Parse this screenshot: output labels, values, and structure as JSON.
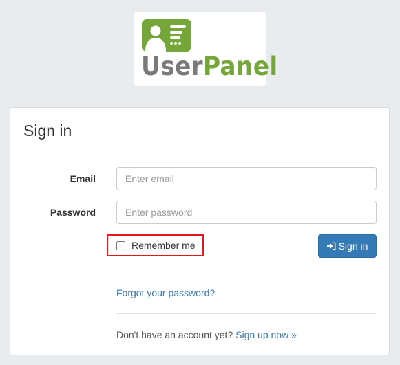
{
  "logo": {
    "text_user": "User",
    "text_panel": "Panel",
    "icon": "user-card-icon",
    "colors": {
      "green": "#74a63a",
      "gray": "#7a7a7a"
    }
  },
  "form": {
    "title": "Sign in",
    "email": {
      "label": "Email",
      "placeholder": "Enter email",
      "value": ""
    },
    "password": {
      "label": "Password",
      "placeholder": "Enter password",
      "value": ""
    },
    "remember": {
      "label": "Remember me",
      "checked": false
    },
    "submit": {
      "label": "Sign in",
      "icon": "sign-in-icon"
    },
    "forgot": {
      "label": "Forgot your password?"
    },
    "signup": {
      "prompt": "Don't have an account yet?",
      "link_label": "Sign up now »"
    }
  },
  "colors": {
    "page_background": "#e8ecee",
    "primary": "#337ab7",
    "highlight_border": "#e0181c"
  }
}
